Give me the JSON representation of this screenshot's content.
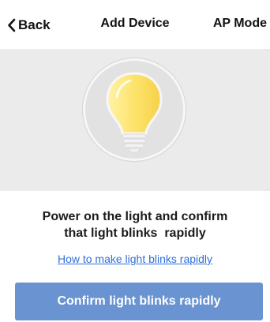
{
  "nav": {
    "back_label": "Back",
    "title": "Add Device",
    "right_action": "AP Mode"
  },
  "hero": {
    "illustration": "light-bulb-icon"
  },
  "content": {
    "instruction_line1": "Power on the light and confirm",
    "instruction_line2": "that light blinks  rapidly",
    "help_link": "How to make light blinks rapidly"
  },
  "footer": {
    "confirm_label": "Confirm light blinks rapidly"
  },
  "colors": {
    "accent": "#6a93d1",
    "link": "#2f6fd8",
    "hero_bg": "#ebebeb",
    "bulb": "#fce26a"
  }
}
